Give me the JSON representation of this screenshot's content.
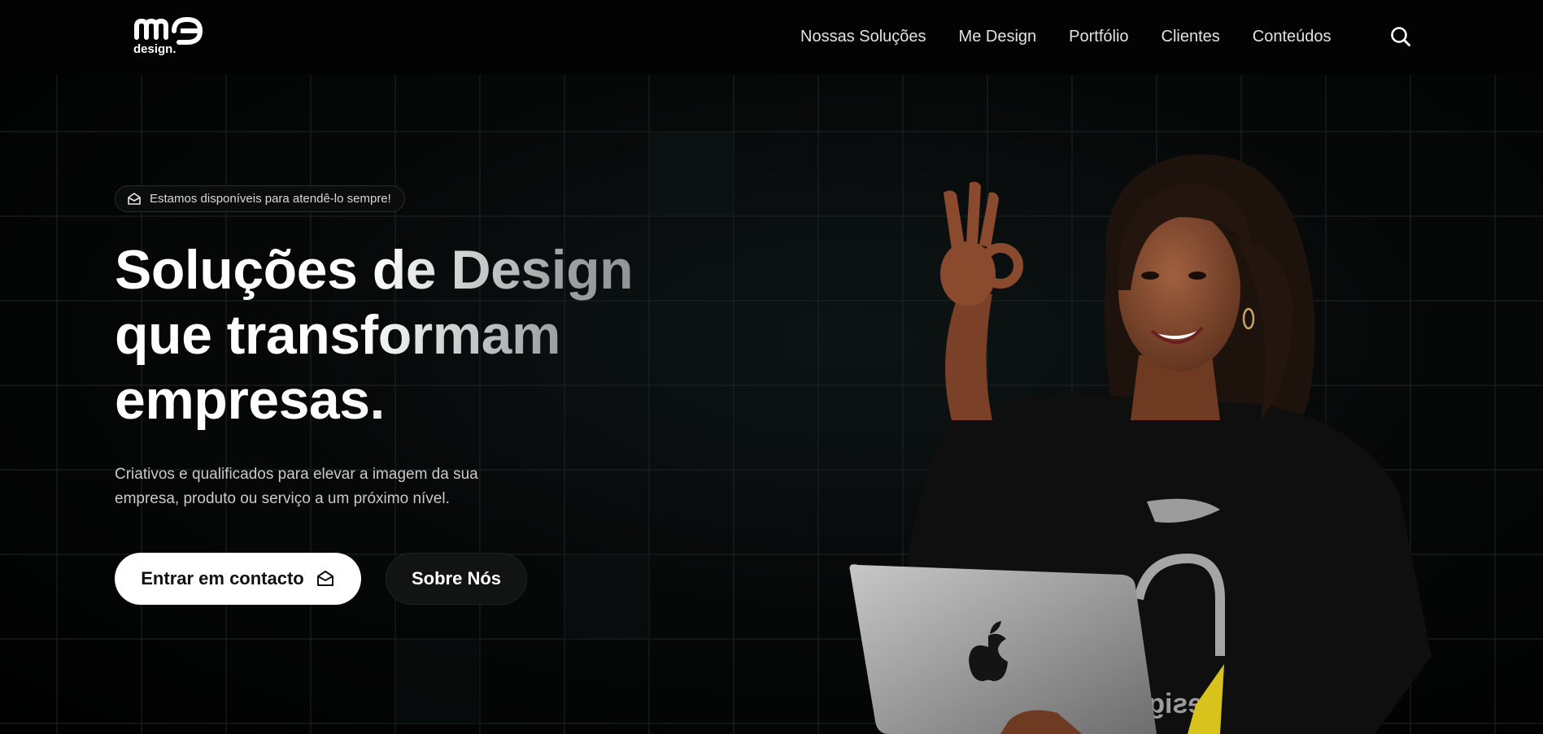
{
  "header": {
    "logo_text_top": "me",
    "logo_text_bottom": "design.",
    "nav": [
      {
        "label": "Nossas Soluções"
      },
      {
        "label": "Me Design"
      },
      {
        "label": "Portfólio"
      },
      {
        "label": "Clientes"
      },
      {
        "label": "Conteúdos"
      }
    ],
    "search_icon": "search-icon"
  },
  "hero": {
    "badge": {
      "icon": "mail-open-icon",
      "text": "Estamos disponíveis para atendê-lo sempre!"
    },
    "headline": [
      "Soluções de Design",
      "que transformam",
      "empresas."
    ],
    "subtitle": "Criativos e qualificados para elevar a imagem da sua empresa, produto ou serviço a um próximo nível.",
    "primary_button": {
      "label": "Entrar em contacto",
      "icon": "mail-icon"
    },
    "secondary_button": {
      "label": "Sobre Nós"
    },
    "laptop_logo_icon": "apple-logo-icon",
    "shirt_print": "design"
  },
  "colors": {
    "background": "#000000",
    "header_bg": "#030303",
    "text_primary": "#ffffff",
    "text_muted": "#c9c9c9",
    "button_primary_bg": "#ffffff",
    "button_secondary_bg": "#121414"
  }
}
